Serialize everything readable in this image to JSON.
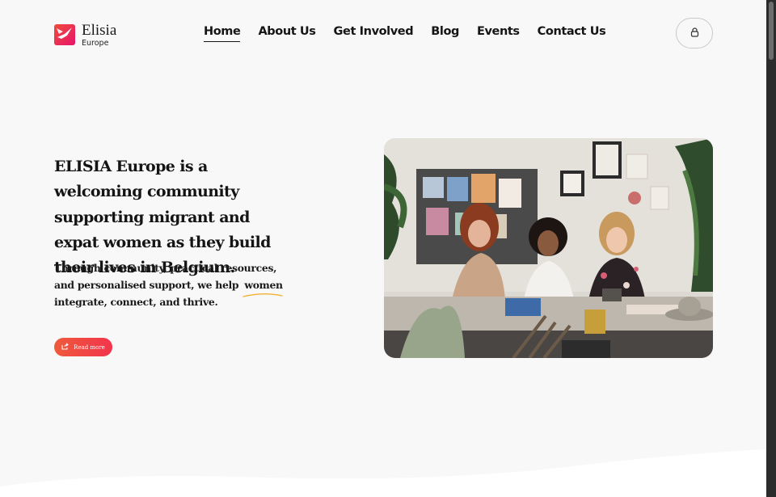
{
  "brand": {
    "name": "Elisia",
    "sub": "Europe",
    "colors": {
      "red": "#f2344c",
      "orange": "#ee5a3c",
      "dark": "#151515",
      "bg": "#f8f8f9"
    }
  },
  "nav": {
    "items": [
      {
        "label": "Home",
        "active": true
      },
      {
        "label": "About Us",
        "active": false
      },
      {
        "label": "Get Involved",
        "active": false
      },
      {
        "label": "Blog",
        "active": false
      },
      {
        "label": "Events",
        "active": false
      },
      {
        "label": "Contact Us",
        "active": false
      }
    ]
  },
  "account": {
    "icon": "lock-icon"
  },
  "hero": {
    "title": "ELISIA Europe is a welcoming community supporting migrant and expat women as they build their lives in Belgium.",
    "sub_before": "Through community, practical resources, and personalised support, we help",
    "sub_highlight": "women",
    "sub_after": "integrate, connect, and thrive.",
    "cta_label": "Read more",
    "cta_icon": "share-icon",
    "image_alt": "Three women laughing together at a table in an art studio"
  }
}
